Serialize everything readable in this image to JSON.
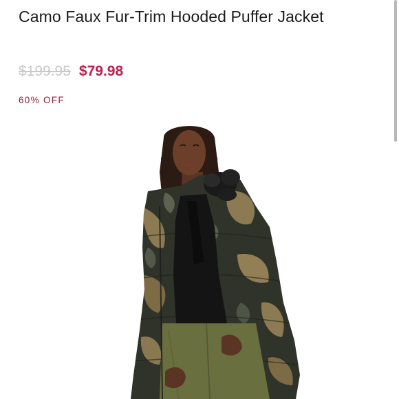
{
  "product": {
    "title": "Camo Faux Fur-Trim Hooded Puffer Jacket",
    "original_price": "$199.95",
    "sale_price": "$79.98",
    "discount": "60% OFF"
  },
  "colors": {
    "sale_price": "#c01c4e",
    "discount": "#9a1b3a",
    "original_price": "#c9c9c9"
  },
  "icons": [
    "scrollbar"
  ]
}
